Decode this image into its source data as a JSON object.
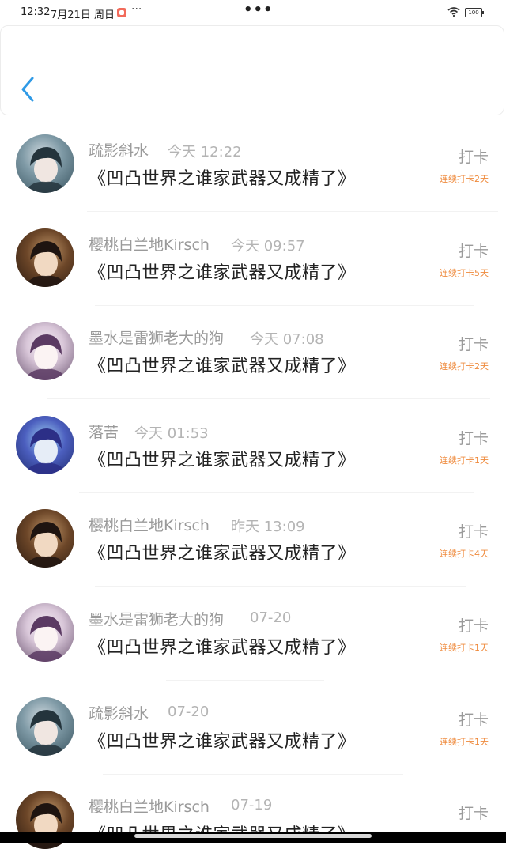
{
  "status_bar": {
    "time": "12:32",
    "date": "7月21日 周日",
    "more_left": "···",
    "more_center": "•••",
    "battery": "100"
  },
  "colors": {
    "accent_back": "#2f9ae6",
    "streak": "#ef8a3c",
    "name": "#9a9a9a",
    "title": "#222222"
  },
  "entries": [
    {
      "name": "疏影斜水",
      "time": "今天 12:22",
      "title": "《凹凸世界之谁家武器又成精了》",
      "action": "打卡",
      "streak": "连续打卡2天",
      "avatar": "avatar-a"
    },
    {
      "name": "樱桃白兰地Kirsch",
      "time": "今天 09:57",
      "title": "《凹凸世界之谁家武器又成精了》",
      "action": "打卡",
      "streak": "连续打卡5天",
      "avatar": "avatar-b"
    },
    {
      "name": "墨水是雷狮老大的狗",
      "time": "今天 07:08",
      "title": "《凹凸世界之谁家武器又成精了》",
      "action": "打卡",
      "streak": "连续打卡2天",
      "avatar": "avatar-c"
    },
    {
      "name": "落苦",
      "time": "今天 01:53",
      "title": "《凹凸世界之谁家武器又成精了》",
      "action": "打卡",
      "streak": "连续打卡1天",
      "avatar": "avatar-d"
    },
    {
      "name": "樱桃白兰地Kirsch",
      "time": "昨天 13:09",
      "title": "《凹凸世界之谁家武器又成精了》",
      "action": "打卡",
      "streak": "连续打卡4天",
      "avatar": "avatar-b"
    },
    {
      "name": "墨水是雷狮老大的狗",
      "time": "07-20",
      "title": "《凹凸世界之谁家武器又成精了》",
      "action": "打卡",
      "streak": "连续打卡1天",
      "avatar": "avatar-c"
    },
    {
      "name": "疏影斜水",
      "time": "07-20",
      "title": "《凹凸世界之谁家武器又成精了》",
      "action": "打卡",
      "streak": "连续打卡1天",
      "avatar": "avatar-a"
    },
    {
      "name": "樱桃白兰地Kirsch",
      "time": "07-19",
      "title": "《凹凸世界之谁家武器又成精了》",
      "action": "打卡",
      "streak": "",
      "avatar": "avatar-b"
    }
  ]
}
